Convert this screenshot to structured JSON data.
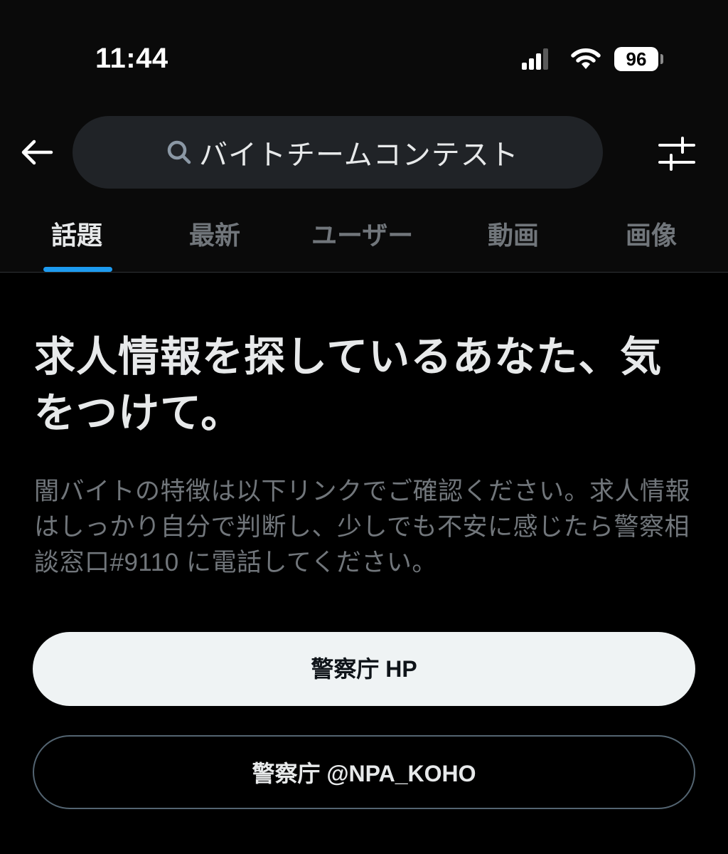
{
  "status_bar": {
    "time": "11:44",
    "battery": "96"
  },
  "header": {
    "back_icon": "arrow-left-icon",
    "search": {
      "icon": "search-icon",
      "query": "バイトチームコンテスト"
    },
    "filter_icon": "sliders-icon"
  },
  "tabs": [
    {
      "label": "話題",
      "active": true
    },
    {
      "label": "最新",
      "active": false
    },
    {
      "label": "ユーザー",
      "active": false
    },
    {
      "label": "動画",
      "active": false
    },
    {
      "label": "画像",
      "active": false
    }
  ],
  "notice": {
    "headline": "求人情報を探しているあなた、気をつけて。",
    "description": "闇バイトの特徴は以下リンクでご確認ください。求人情報はしっかり自分で判断し、少しでも不安に感じたら警察相談窓口#9110 に電話してください。",
    "primary_button": "警察庁 HP",
    "secondary_button": "警察庁 @NPA_KOHO"
  },
  "colors": {
    "background": "#000000",
    "accent": "#1d9bf0",
    "primary_text": "#e7e9ea",
    "secondary_text": "#71767b"
  }
}
